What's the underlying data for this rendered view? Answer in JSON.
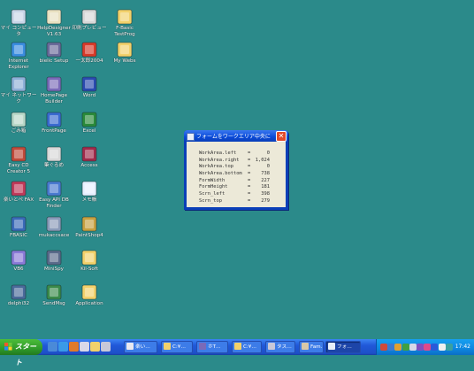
{
  "desktop_icons": [
    {
      "label": "マイ コンピュータ",
      "icon": "my-computer-icon",
      "color": "#c9d6e8",
      "name": "desktop-icon-my-computer"
    },
    {
      "label": "HelpDesigner\nV1.63",
      "icon": "help-designer-icon",
      "color": "#e8e0c0",
      "name": "desktop-icon-helpdesigner"
    },
    {
      "label": "印刷プレビュー",
      "icon": "print-preview-icon",
      "color": "#d8d8d8",
      "name": "desktop-icon-print-preview"
    },
    {
      "label": "F-Basic\nTestProg",
      "icon": "folder-icon",
      "color": "#f2d16b",
      "name": "desktop-icon-fbasic-testprog"
    },
    {
      "label": "Internet\nExplorer",
      "icon": "internet-explorer-icon",
      "color": "#3a8de0",
      "name": "desktop-icon-internet-explorer"
    },
    {
      "label": "bielic Setup",
      "icon": "setup-icon",
      "color": "#6a6a9a",
      "name": "desktop-icon-bielic-setup"
    },
    {
      "label": "一太郎2004",
      "icon": "ichitaro-icon",
      "color": "#d83a2a",
      "name": "desktop-icon-ichitaro"
    },
    {
      "label": "My Webs",
      "icon": "folder-web-icon",
      "color": "#f2d16b",
      "name": "desktop-icon-my-webs"
    },
    {
      "label": "マイ ネットワーク",
      "icon": "my-network-icon",
      "color": "#8fb0d8",
      "name": "desktop-icon-my-network"
    },
    {
      "label": "HomePage\nBuilder",
      "icon": "homepage-builder-icon",
      "color": "#7a6ab8",
      "name": "desktop-icon-homepage-builder"
    },
    {
      "label": "Word",
      "icon": "word-icon",
      "color": "#2a4ab0",
      "name": "desktop-icon-word"
    },
    {
      "label": "ごみ箱",
      "icon": "recycle-bin-icon",
      "color": "#b8d8c8",
      "name": "desktop-icon-recycle-bin"
    },
    {
      "label": "FrontPage",
      "icon": "frontpage-icon",
      "color": "#3a6ad0",
      "name": "desktop-icon-frontpage"
    },
    {
      "label": "Excel",
      "icon": "excel-icon",
      "color": "#2a8a3a",
      "name": "desktop-icon-excel"
    },
    {
      "label": "Easy CD\nCreator 5",
      "icon": "easy-cd-creator-icon",
      "color": "#c04a3a",
      "name": "desktop-icon-easy-cd-creator"
    },
    {
      "label": "筆ぐるめ",
      "icon": "fudegurume-icon",
      "color": "#d8d8d8",
      "name": "desktop-icon-fudegurume"
    },
    {
      "label": "Access",
      "icon": "access-icon",
      "color": "#a02a4a",
      "name": "desktop-icon-access"
    },
    {
      "label": "楽いとぺ FAX",
      "icon": "fax-icon",
      "color": "#c03a5a",
      "name": "desktop-icon-fax"
    },
    {
      "label": "Easy API DB\nFinder",
      "icon": "api-db-finder-icon",
      "color": "#4a7ad0",
      "name": "desktop-icon-easy-api-db-finder"
    },
    {
      "label": "メモ帳",
      "icon": "notepad-icon",
      "color": "#e8f0ff",
      "name": "desktop-icon-notepad"
    },
    {
      "label": "FBASIC",
      "icon": "fbasic-icon",
      "color": "#3a6ab8",
      "name": "desktop-icon-fbasic"
    },
    {
      "label": "mukaccsace",
      "icon": "mukaccsace-icon",
      "color": "#8a9ab8",
      "name": "desktop-icon-mukaccsace"
    },
    {
      "label": "PaintShop4",
      "icon": "paintshop-icon",
      "color": "#c8a040",
      "name": "desktop-icon-paintshop"
    },
    {
      "label": "VB6",
      "icon": "vb6-icon",
      "color": "#8a7ad8",
      "name": "desktop-icon-vb6"
    },
    {
      "label": "MiniSpy",
      "icon": "minispy-icon",
      "color": "#5a6a8a",
      "name": "desktop-icon-minispy"
    },
    {
      "label": "Kil-Soft",
      "icon": "folder-icon",
      "color": "#f2d16b",
      "name": "desktop-icon-kil-soft"
    },
    {
      "label": "delphi32",
      "icon": "delphi-icon",
      "color": "#4a6a9a",
      "name": "desktop-icon-delphi32"
    },
    {
      "label": "SendMsg",
      "icon": "sendmsg-icon",
      "color": "#3a8a4a",
      "name": "desktop-icon-sendmsg"
    },
    {
      "label": "Application",
      "icon": "folder-icon",
      "color": "#f2d16b",
      "name": "desktop-icon-application"
    }
  ],
  "window": {
    "title": "フォームをワークエリア中央に",
    "close_label": "✕",
    "rows": [
      {
        "key": "WorkArea.left",
        "eq": "=",
        "value": "0"
      },
      {
        "key": "WorkArea.right",
        "eq": "=",
        "value": "1,024"
      },
      {
        "key": "WorkArea.top",
        "eq": "=",
        "value": "0"
      },
      {
        "key": "WorkArea.bottom",
        "eq": "=",
        "value": "738"
      },
      {
        "key": "FormWidth",
        "eq": "=",
        "value": "227"
      },
      {
        "key": "FormHeight",
        "eq": "=",
        "value": "181"
      },
      {
        "key": "Scrn_left",
        "eq": "=",
        "value": "398"
      },
      {
        "key": "Scrn_top",
        "eq": "=",
        "value": "279"
      }
    ]
  },
  "taskbar": {
    "start_label": "スタート",
    "quick_launch": [
      {
        "icon": "ql-desktop-icon",
        "color": "#4a8ad8"
      },
      {
        "icon": "ql-ie-icon",
        "color": "#3a9ae8"
      },
      {
        "icon": "ql-media-icon",
        "color": "#e07a2a"
      },
      {
        "icon": "ql-app-icon",
        "color": "#d8d8e8"
      },
      {
        "icon": "ql-folder-icon",
        "color": "#f2d16b"
      },
      {
        "icon": "ql-app2-icon",
        "color": "#c8c8d8"
      }
    ],
    "tasks": [
      {
        "label": "楽い…",
        "icon": "task-window-icon",
        "color": "#e8e8f0",
        "active": false
      },
      {
        "label": "C:¥…",
        "icon": "task-folder-icon",
        "color": "#f2d16b",
        "active": false
      },
      {
        "label": "ホT…",
        "icon": "task-homepage-icon",
        "color": "#7a6ab8",
        "active": false
      },
      {
        "label": "C:¥…",
        "icon": "task-folder-icon",
        "color": "#f2d16b",
        "active": false
      },
      {
        "label": "タス…",
        "icon": "task-app-icon",
        "color": "#c8c8d8",
        "active": false
      },
      {
        "label": "Fam…",
        "icon": "task-app-icon",
        "color": "#d8c8a8",
        "active": false
      },
      {
        "label": "フォ…",
        "icon": "task-form-icon",
        "color": "#e8eef8",
        "active": true
      }
    ],
    "clock": "17:42"
  },
  "tray_icons": [
    {
      "icon": "tray-icon-1",
      "color": "#d04a3a"
    },
    {
      "icon": "tray-icon-2",
      "color": "#3a7ad0"
    },
    {
      "icon": "tray-icon-3",
      "color": "#e0a030"
    },
    {
      "icon": "tray-icon-4",
      "color": "#40a040"
    },
    {
      "icon": "tray-icon-5",
      "color": "#d8d8e8"
    },
    {
      "icon": "tray-icon-6",
      "color": "#8050c0"
    },
    {
      "icon": "tray-icon-7",
      "color": "#e04a8a"
    },
    {
      "icon": "tray-icon-8",
      "color": "#2a5ad8"
    },
    {
      "icon": "tray-icon-9",
      "color": "#f0f0f0"
    },
    {
      "icon": "tray-icon-10",
      "color": "#3aa0a0"
    }
  ]
}
